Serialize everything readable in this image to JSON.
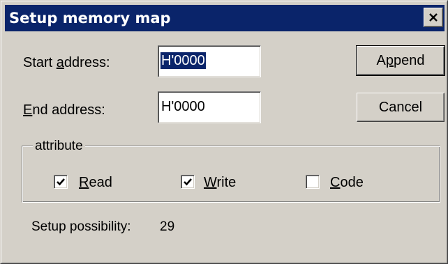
{
  "dialog": {
    "title": "Setup memory map"
  },
  "fields": {
    "start_label_pre": "Start ",
    "start_label_key": "a",
    "start_label_post": "ddress:",
    "start_value": "H'0000",
    "end_label_key": "E",
    "end_label_post": "nd address:",
    "end_value": "H'0000"
  },
  "buttons": {
    "append_pre": "A",
    "append_key": "p",
    "append_post": "pend",
    "cancel": "Cancel"
  },
  "attribute": {
    "legend": "attribute",
    "read": {
      "key": "R",
      "rest": "ead",
      "checked": true
    },
    "write": {
      "key": "W",
      "rest": "rite",
      "checked": true
    },
    "code": {
      "key": "C",
      "rest": "ode",
      "checked": false
    }
  },
  "status": {
    "label": "Setup possibility:",
    "value": "29"
  },
  "colors": {
    "title_bar": "#0a246a",
    "dialog_face": "#d4d0c8",
    "selection": "#0a246a"
  }
}
